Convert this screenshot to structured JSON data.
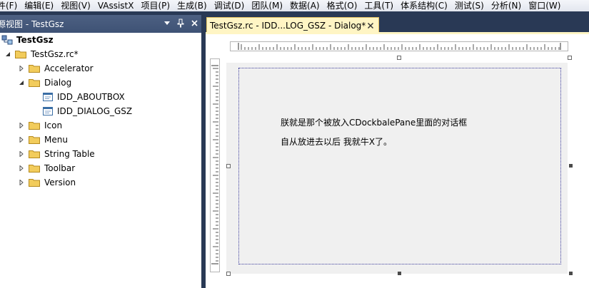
{
  "menu": [
    "件(F)",
    "编辑(E)",
    "视图(V)",
    "VAssistX",
    "项目(P)",
    "生成(B)",
    "调试(D)",
    "团队(M)",
    "数据(A)",
    "格式(O)",
    "工具(T)",
    "体系结构(C)",
    "测试(S)",
    "分析(N)",
    "窗口(W)"
  ],
  "resource_view": {
    "title": "源视图 - TestGsz",
    "root": "TestGsz",
    "rc_file": "TestGsz.rc*",
    "folders": [
      "Accelerator",
      "Dialog",
      "Icon",
      "Menu",
      "String Table",
      "Toolbar",
      "Version"
    ],
    "dialog_items": [
      "IDD_ABOUTBOX",
      "IDD_DIALOG_GSZ"
    ]
  },
  "document_tab": {
    "label": "TestGsz.rc - IDD...LOG_GSZ - Dialog*"
  },
  "dialog": {
    "line1": "朕就是那个被放入CDockbalePane里面的对话框",
    "line2": "自从放进去以后 我就牛X了。"
  },
  "colors": {
    "accent": "#293955",
    "tab": "#fff5c4",
    "canvas": "#f0f0f0"
  }
}
